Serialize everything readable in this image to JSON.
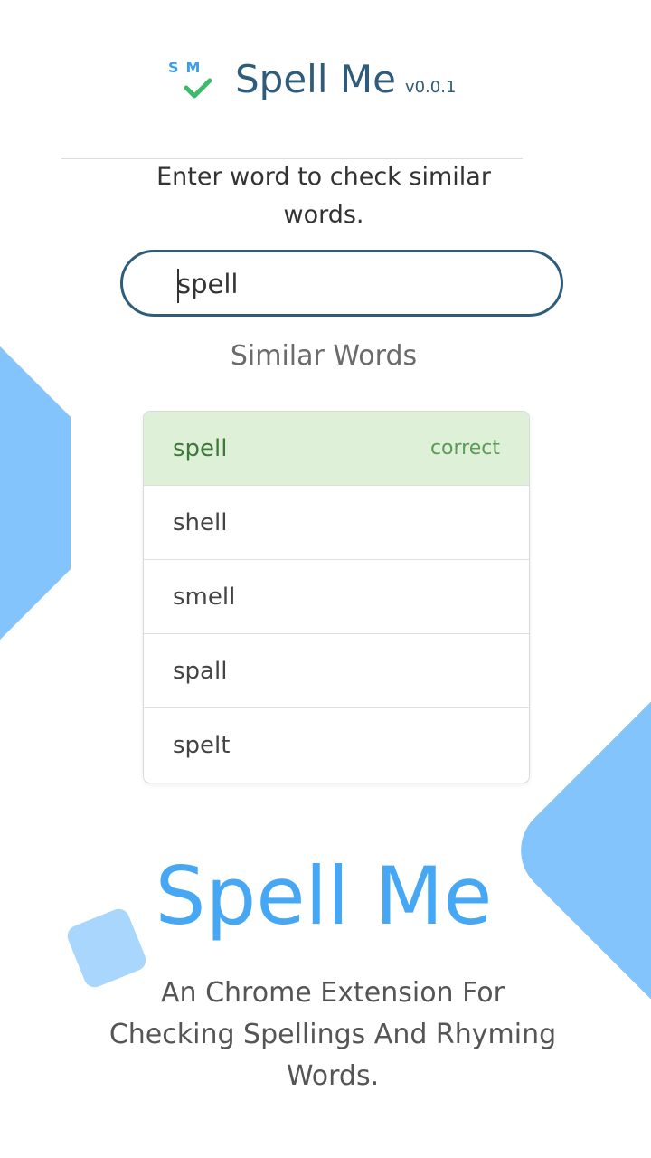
{
  "header": {
    "logo_letters": "SM",
    "title": "Spell Me",
    "version": "v0.0.1"
  },
  "search": {
    "prompt": "Enter word to check similar words.",
    "value": "spell",
    "placeholder": ""
  },
  "results": {
    "heading": "Similar Words",
    "items": [
      {
        "word": "spell",
        "status": "correct"
      },
      {
        "word": "shell",
        "status": ""
      },
      {
        "word": "smell",
        "status": ""
      },
      {
        "word": "spall",
        "status": ""
      },
      {
        "word": "spelt",
        "status": ""
      }
    ]
  },
  "promo": {
    "title": "Spell Me",
    "description": "An Chrome Extension For Checking Spellings And Rhyming Words."
  },
  "colors": {
    "brand_dark": "#2f5c7a",
    "brand_blue": "#46a8f4",
    "logo_green": "#3dba6c",
    "correct_bg": "#dff0d8",
    "decor_blue": "#82c4fb"
  }
}
